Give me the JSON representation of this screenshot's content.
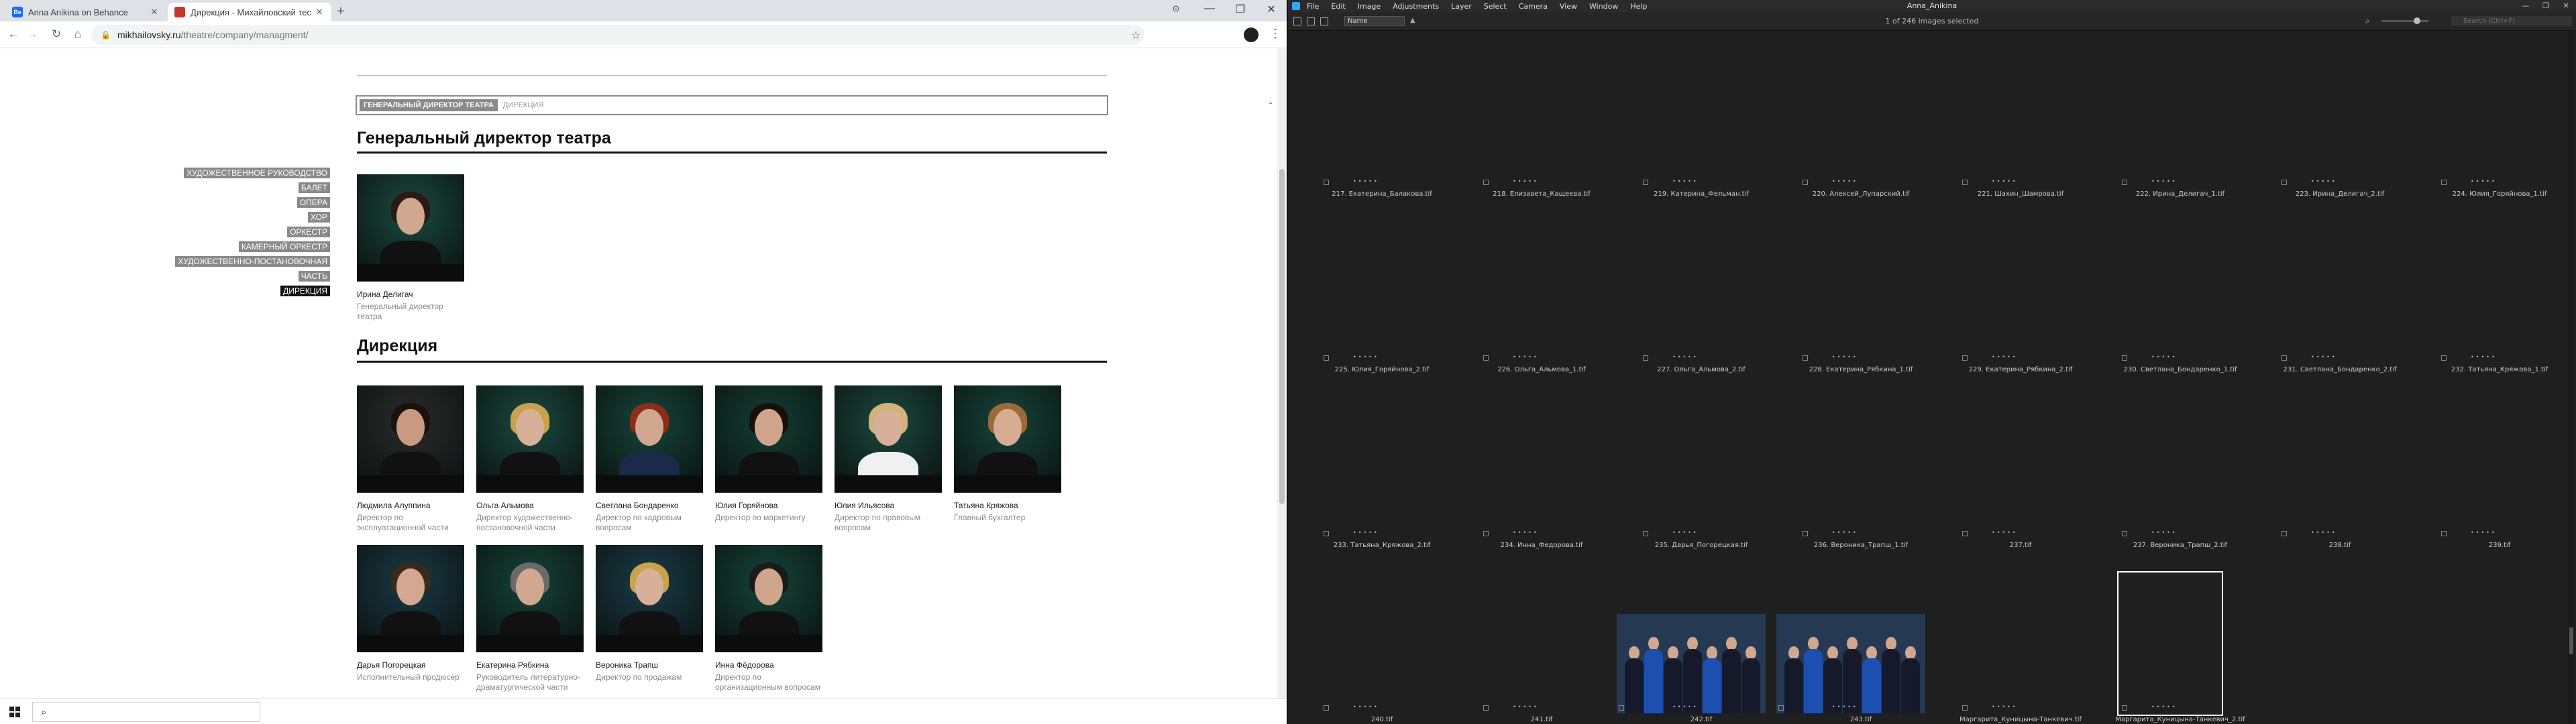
{
  "browser": {
    "tabs": [
      {
        "label": "Anna Anikina on Behance",
        "favicon_color": "#1769ff",
        "favicon_text": "Be"
      },
      {
        "label": "Дирекция - Михайловский тес",
        "favicon_color": "#c0392b",
        "favicon_text": "",
        "active": true
      }
    ],
    "url_host": "mikhailovsky.ru",
    "url_path": "/theatre/company/managment/",
    "window_controls": [
      "—",
      "❐",
      "✕"
    ]
  },
  "page": {
    "tabs": [
      {
        "label": "ГЕНЕРАЛЬНЫЙ ДИРЕКТОР ТЕАТРА",
        "active": true
      },
      {
        "label": "ДИРЕКЦИЯ",
        "active": false
      }
    ],
    "section1_title": "Генеральный директор театра",
    "section2_title": "Дирекция",
    "side_menu": [
      {
        "label": "ХУДОЖЕСТВЕННОЕ РУКОВОДСТВО"
      },
      {
        "label": "БАЛЕТ"
      },
      {
        "label": "ОПЕРА"
      },
      {
        "label": "ХОР"
      },
      {
        "label": "ОРКЕСТР"
      },
      {
        "label": "КАМЕРНЫЙ ОРКЕСТР"
      },
      {
        "label": "ХУДОЖЕСТВЕННО-ПОСТАНОВОЧНАЯ"
      },
      {
        "label": "ЧАСТЬ"
      },
      {
        "label": "ДИРЕКЦИЯ",
        "active": true
      }
    ],
    "director": {
      "name": "Ирина Делигач",
      "role": "Генеральный директор театра"
    },
    "people": [
      {
        "name": "Людмила Алуппина",
        "role": "Директор по эксплуатационной части"
      },
      {
        "name": "Ольга Альмова",
        "role": "Директор художественно-постановочной части"
      },
      {
        "name": "Светлана Бондаренко",
        "role": "Директор по кадровым вопросам"
      },
      {
        "name": "Юлия Горяйнова",
        "role": "Директор по маркетингу"
      },
      {
        "name": "Юлия Ильясова",
        "role": "Директор по правовым вопросам"
      },
      {
        "name": "Татьяна Кряжова",
        "role": "Главный бухгалтер"
      },
      {
        "name": "Дарья Погорецкая",
        "role": "Исполнительный продюсер"
      },
      {
        "name": "Екатерина Рябкина",
        "role": "Руководитель литературно-драматургической части"
      },
      {
        "name": "Вероника Трапш",
        "role": "Директор по продажам"
      },
      {
        "name": "Инна Фёдорова",
        "role": "Директор по организационным вопросам"
      }
    ]
  },
  "taskbar": {
    "search_icon": "search-icon"
  },
  "editor": {
    "app_title": "Anna_Anikina",
    "menu": [
      "File",
      "Edit",
      "Image",
      "Adjustments",
      "Layer",
      "Select",
      "Camera",
      "View",
      "Window",
      "Help"
    ],
    "sort_label": "Name",
    "selection_status": "1 of 246 images selected",
    "search_placeholder": "Search (Ctrl+F)",
    "thumbnails": [
      {
        "caption": "217. Екатерина_Балакова.tif",
        "bg": "#2f3e44",
        "cloth": "#e8e8e8",
        "hair": "#1a1410"
      },
      {
        "caption": "218. Елизавета_Кащеева.tif",
        "bg": "#31464e",
        "cloth": "#111",
        "hair": "#1a120c"
      },
      {
        "caption": "219. Катерина_Фельман.tif",
        "bg": "#2a3a3f",
        "cloth": "#111",
        "hair": "#5a3a22"
      },
      {
        "caption": "220. Алексей_Лупарский.tif",
        "bg": "#263438",
        "cloth": "#0d0d0d",
        "hair": "#1b1b1b"
      },
      {
        "caption": "221. Шахин_Шамрова.tif",
        "bg": "#2b3b3f",
        "cloth": "#111",
        "hair": "#120c08"
      },
      {
        "caption": "222. Ирина_Делигач_1.tif",
        "bg": "#124a3c",
        "cloth": "#111",
        "hair": "#2a1a12"
      },
      {
        "caption": "223. Ирина_Делигач_2.tif",
        "bg": "#124a3c",
        "cloth": "#111",
        "hair": "#2a1a12"
      },
      {
        "caption": "224. Юлия_Горяйнова_1.tif",
        "bg": "#123f32",
        "cloth": "#1b2140",
        "hair": "#1a100a"
      },
      {
        "caption": "225. Юлия_Горяйнова_2.tif",
        "bg": "#1f3a50",
        "cloth": "#1d2445",
        "hair": "#1a100a"
      },
      {
        "caption": "226. Ольга_Альмова_1.tif",
        "bg": "#1a4a40",
        "cloth": "#111",
        "hair": "#c9a24e"
      },
      {
        "caption": "227. Ольга_Альмова_2.tif",
        "bg": "#223746",
        "cloth": "#111",
        "hair": "#c9a24e"
      },
      {
        "caption": "228. Екатерина_Рябкина_1.tif",
        "bg": "#114236",
        "cloth": "#111",
        "hair": "#5b5b5b"
      },
      {
        "caption": "229. Екатерина_Рябкина_2.tif",
        "bg": "#1a4a40",
        "cloth": "#111",
        "hair": "#5b5b5b"
      },
      {
        "caption": "230. Светлана_Бондаренко_1.tif",
        "bg": "#134538",
        "cloth": "#1b2a4a",
        "hair": "#7a2a1a"
      },
      {
        "caption": "231. Светлана_Бондаренко_2.tif",
        "bg": "#13463a",
        "cloth": "#1b2a4a",
        "hair": "#8a2e1a"
      },
      {
        "caption": "232. Татьяна_Кряжова_1.tif",
        "bg": "#123f32",
        "cloth": "#111",
        "hair": "#8a5a2a"
      },
      {
        "caption": "233. Татьяна_Кряжова_2.tif",
        "bg": "#0f3d30",
        "cloth": "#111",
        "hair": "#8a5a2a"
      },
      {
        "caption": "234. Инна_Федорова.tif",
        "bg": "#1d2f36",
        "cloth": "#111",
        "hair": "#1b1b1b"
      },
      {
        "caption": "235. Дарья_Погорецкая.tif",
        "bg": "#2a3a40",
        "cloth": "#b01c1c",
        "hair": "#3a2a1a"
      },
      {
        "caption": "236. Вероника_Трапш_1.tif",
        "bg": "#1a4a40",
        "cloth": "#111",
        "hair": "#c9a24e"
      },
      {
        "caption": "237.tif",
        "bg": "#1f3a50",
        "cloth": "#111",
        "hair": "#3a2412"
      },
      {
        "caption": "237. Вероника_Трапш_2.tif",
        "bg": "#13463a",
        "cloth": "#111",
        "hair": "#c9a24e"
      },
      {
        "caption": "238.tif",
        "bg": "#1f3a50",
        "cloth": "#111",
        "hair": "#d9c08a"
      },
      {
        "caption": "239.tif",
        "bg": "#1d3346",
        "cloth": "#eeeeee",
        "hair": "#d9c08a"
      },
      {
        "caption": "240.tif",
        "bg": "#1f3a50",
        "cloth": "#1a4fb0",
        "hair": "#1a1208"
      },
      {
        "caption": "241.tif",
        "bg": "#1f3a50",
        "cloth": "#7a9aa8",
        "hair": "#1a1208"
      },
      {
        "caption": "242.tif",
        "bg": "#253a52",
        "cloth": "#223a6a",
        "hair": "#2a1a12",
        "group": true
      },
      {
        "caption": "243.tif",
        "bg": "#253a52",
        "cloth": "#1c3a7a",
        "hair": "#2a1a12",
        "group": true
      },
      {
        "caption": "Маргарита_Куницына-Танкевич.tif",
        "bg": "#1a4a40",
        "cloth": "#111",
        "hair": "#6a3a1a"
      },
      {
        "caption": "Маргарита_Куницына-Танкевич_2.tif",
        "bg": "#1a4038",
        "cloth": "#111",
        "hair": "#6a3a1a",
        "selected": true
      }
    ]
  }
}
